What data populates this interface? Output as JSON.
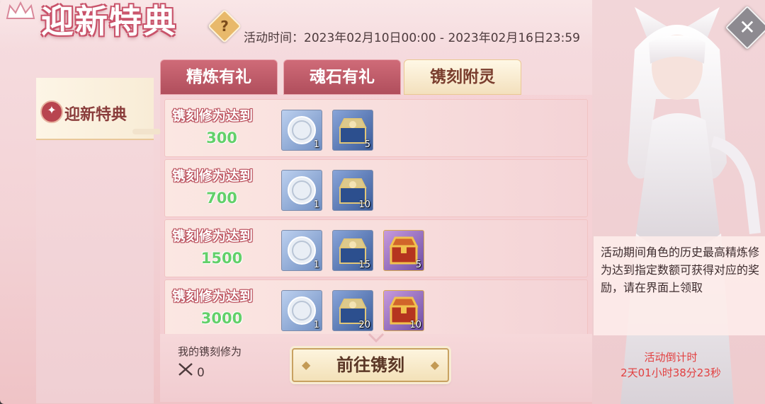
{
  "header": {
    "title": "迎新特典",
    "help_icon": "?",
    "event_time": "活动时间：2023年02月10日00:00 - 2023年02月16日23:59"
  },
  "sidebar": {
    "items": [
      {
        "label": "迎新特典",
        "icon": "emblem-icon"
      }
    ]
  },
  "tabs": [
    {
      "label": "精炼有礼",
      "active": false
    },
    {
      "label": "魂石有礼",
      "active": false
    },
    {
      "label": "镌刻附灵",
      "active": true
    }
  ],
  "rewards": [
    {
      "title": "镌刻修为达到",
      "value": "300",
      "items": [
        {
          "type": "silver-coin",
          "qty": "1"
        },
        {
          "type": "blue-chest",
          "qty": "5"
        }
      ]
    },
    {
      "title": "镌刻修为达到",
      "value": "700",
      "items": [
        {
          "type": "silver-coin",
          "qty": "1"
        },
        {
          "type": "blue-chest",
          "qty": "10"
        }
      ]
    },
    {
      "title": "镌刻修为达到",
      "value": "1500",
      "items": [
        {
          "type": "silver-coin",
          "qty": "1"
        },
        {
          "type": "blue-chest",
          "qty": "15"
        },
        {
          "type": "gold-chest",
          "qty": "5"
        }
      ]
    },
    {
      "title": "镌刻修为达到",
      "value": "3000",
      "items": [
        {
          "type": "silver-coin",
          "qty": "1"
        },
        {
          "type": "blue-chest",
          "qty": "20"
        },
        {
          "type": "gold-chest",
          "qty": "10"
        }
      ]
    }
  ],
  "bottom": {
    "my_label": "我的镌刻修为",
    "my_value": "0",
    "goto_label": "前往镌刻"
  },
  "info": {
    "description": "活动期间角色的历史最高精炼修为达到指定数额可获得对应的奖励，请在界面上领取",
    "countdown_label": "活动倒计时",
    "countdown_value": "2天01小时38分23秒"
  },
  "colors": {
    "accent": "#c9536a",
    "value_green": "#63d06a",
    "countdown_red": "#e24040"
  }
}
